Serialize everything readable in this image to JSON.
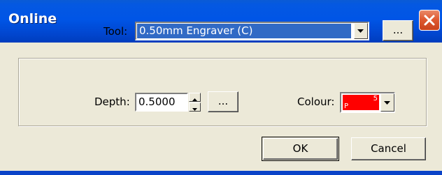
{
  "window": {
    "title": "Online"
  },
  "form": {
    "tool_label": "Tool:",
    "tool_value": "0.50mm Engraver (C)",
    "tool_browse_label": "...",
    "depth_label": "Depth:",
    "depth_value": "0.5000",
    "depth_browse_label": "...",
    "colour_label": "Colour:",
    "colour_swatch": {
      "color": "#ff0000",
      "left_text": "P",
      "right_text": "5"
    }
  },
  "buttons": {
    "ok_label": "OK",
    "cancel_label": "Cancel"
  },
  "theme": {
    "titlebar_color": "#0055e6",
    "selection_color": "#316ac5",
    "dialog_background": "#ece9d8"
  }
}
